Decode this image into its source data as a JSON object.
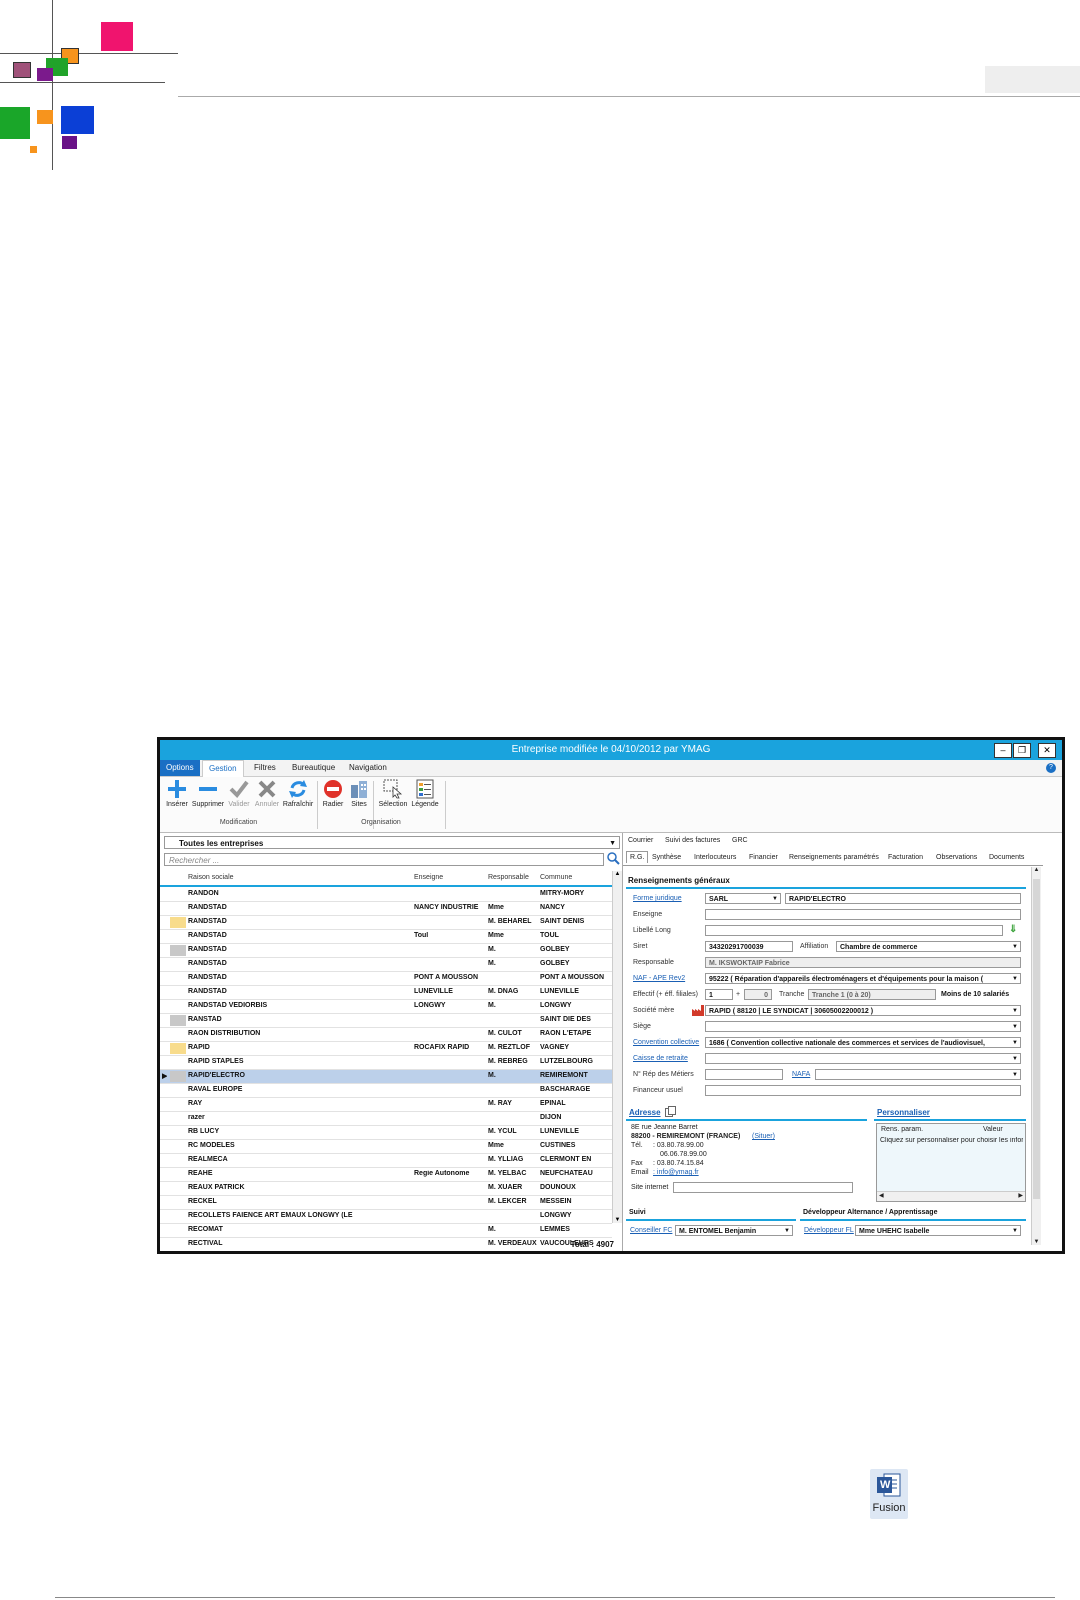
{
  "window": {
    "title": "Entreprise modifiée le 04/10/2012 par YMAG",
    "menu_tabs": [
      "Options",
      "Gestion",
      "Filtres",
      "Bureautique",
      "Navigation"
    ],
    "ribbon": {
      "buttons": [
        "Insérer",
        "Supprimer",
        "Valider",
        "Annuler",
        "Rafraîchir",
        "Radier",
        "Sites",
        "Sélection",
        "Légende"
      ],
      "groups": [
        "Modification",
        "Organisation"
      ]
    }
  },
  "left": {
    "filter": "Toutes les entreprises",
    "search_placeholder": "Rechercher ...",
    "columns": [
      "Raison sociale",
      "Enseigne",
      "Responsable",
      "Commune"
    ],
    "rows": [
      {
        "raison": "RANDON",
        "enseigne": "",
        "resp": "",
        "commune": "MITRY-MORY",
        "chip": ""
      },
      {
        "raison": "RANDSTAD",
        "enseigne": "NANCY INDUSTRIE",
        "resp": "Mme",
        "commune": "NANCY",
        "chip": ""
      },
      {
        "raison": "RANDSTAD",
        "enseigne": "",
        "resp": "M. BEHAREL",
        "commune": "SAINT DENIS",
        "chip": "#f8dc8c"
      },
      {
        "raison": "RANDSTAD",
        "enseigne": "Toul",
        "resp": "Mme",
        "commune": "TOUL",
        "chip": ""
      },
      {
        "raison": "RANDSTAD",
        "enseigne": "",
        "resp": "M.",
        "commune": "GOLBEY",
        "chip": "#c8c8c8"
      },
      {
        "raison": "RANDSTAD",
        "enseigne": "",
        "resp": "M.",
        "commune": "GOLBEY",
        "chip": ""
      },
      {
        "raison": "RANDSTAD",
        "enseigne": "PONT A MOUSSON",
        "resp": "",
        "commune": "PONT A MOUSSON",
        "chip": ""
      },
      {
        "raison": "RANDSTAD",
        "enseigne": "LUNEVILLE",
        "resp": "M. DNAG",
        "commune": "LUNEVILLE",
        "chip": ""
      },
      {
        "raison": "RANDSTAD VEDIORBIS",
        "enseigne": "LONGWY",
        "resp": "M.",
        "commune": "LONGWY",
        "chip": ""
      },
      {
        "raison": "RANSTAD",
        "enseigne": "",
        "resp": "",
        "commune": "SAINT DIE DES",
        "chip": "#c8c8c8"
      },
      {
        "raison": "RAON DISTRIBUTION",
        "enseigne": "",
        "resp": "M. CULOT",
        "commune": "RAON L'ETAPE",
        "chip": ""
      },
      {
        "raison": "RAPID",
        "enseigne": "ROCAFIX RAPID",
        "resp": "M. REZTLOF",
        "commune": "VAGNEY",
        "chip": "#f8dc8c"
      },
      {
        "raison": "RAPID STAPLES",
        "enseigne": "",
        "resp": "M. REBREG",
        "commune": "LUTZELBOURG",
        "chip": ""
      },
      {
        "raison": "RAPID'ELECTRO",
        "enseigne": "",
        "resp": "M.",
        "commune": "REMIREMONT",
        "chip": "#c8c8c8",
        "selected": true
      },
      {
        "raison": "RAVAL EUROPE",
        "enseigne": "",
        "resp": "",
        "commune": "BASCHARAGE",
        "chip": ""
      },
      {
        "raison": "RAY",
        "enseigne": "",
        "resp": "M. RAY",
        "commune": "EPINAL",
        "chip": ""
      },
      {
        "raison": "razer",
        "enseigne": "",
        "resp": "",
        "commune": "DIJON",
        "chip": ""
      },
      {
        "raison": "RB LUCY",
        "enseigne": "",
        "resp": "M. YCUL",
        "commune": "LUNEVILLE",
        "chip": ""
      },
      {
        "raison": "RC MODELES",
        "enseigne": "",
        "resp": "Mme",
        "commune": "CUSTINES",
        "chip": ""
      },
      {
        "raison": "REALMECA",
        "enseigne": "",
        "resp": "M. YLLIAG",
        "commune": "CLERMONT EN",
        "chip": ""
      },
      {
        "raison": "REAHE",
        "enseigne": "Regie Autonome",
        "resp": "M. YELBAC",
        "commune": "NEUFCHATEAU",
        "chip": ""
      },
      {
        "raison": "REAUX PATRICK",
        "enseigne": "",
        "resp": "M. XUAER",
        "commune": "DOUNOUX",
        "chip": ""
      },
      {
        "raison": "RECKEL",
        "enseigne": "",
        "resp": "M. LEKCER",
        "commune": "MESSEIN",
        "chip": ""
      },
      {
        "raison": "RECOLLETS FAIENCE ART EMAUX LONGWY (LE",
        "enseigne": "",
        "resp": "",
        "commune": "LONGWY",
        "chip": ""
      },
      {
        "raison": "RECOMAT",
        "enseigne": "",
        "resp": "M.",
        "commune": "LEMMES",
        "chip": ""
      },
      {
        "raison": "RECTIVAL",
        "enseigne": "",
        "resp": "M. VERDEAUX",
        "commune": "VAUCOULEURS",
        "chip": ""
      }
    ],
    "total": "Total : 4907"
  },
  "right": {
    "top_tabs": [
      "Courrier",
      "Suivi des factures",
      "GRC"
    ],
    "sub_tabs": [
      "R.G.",
      "Synthèse",
      "Interlocuteurs",
      "Financier",
      "Renseignements paramétrés",
      "Facturation",
      "Observations",
      "Documents"
    ],
    "section_rg": "Renseignements généraux",
    "forme_label": "Forme juridique",
    "forme_value": "SARL",
    "raison_value": "RAPID'ELECTRO",
    "enseigne_label": "Enseigne",
    "libelle_label": "Libellé Long",
    "siret_label": "Siret",
    "siret_value": "34320291700039",
    "affiliation_label": "Affiliation",
    "affiliation_value": "Chambre de commerce",
    "responsable_label": "Responsable",
    "responsable_value": "M. IKSWOKTAIP Fabrice",
    "naf_label": "NAF - APE Rev2",
    "naf_value": "95222 ( Réparation d'appareils électroménagers et d'équipements pour la maison (",
    "effectif_label": "Effectif (+ éff. filiales)",
    "effectif_value": "1",
    "effectif_plus": "+",
    "effectif_filiales": "0",
    "tranche_label": "Tranche",
    "tranche_value": "Tranche 1 (0 à 20)",
    "moins_label": "Moins de 10 salariés",
    "societe_label": "Société mère",
    "societe_value": "RAPID ( 88120 | LE SYNDICAT | 30605002200012 )",
    "siege_label": "Siège",
    "convention_label": "Convention collective",
    "convention_value": "1686 ( Convention collective nationale des commerces et services de l'audiovisuel,",
    "caisse_label": "Caisse de retraite",
    "rep_label": "N° Rép des Métiers",
    "nafa_label": "NAFA",
    "financeur_label": "Financeur usuel",
    "adresse_title": "Adresse",
    "address_line1": "8E rue Jeanne Barret",
    "address_line2": "88200 - REMIREMONT (FRANCE)",
    "situer": "(Situer)",
    "tel_label": "Tél.",
    "tel1": ": 03.80.78.99.00",
    "tel2": "06.06.78.99.00",
    "fax_label": "Fax",
    "fax": ": 03.80.74.15.84",
    "email_label": "Email",
    "email": ": info@ymag.fr",
    "site_label": "Site internet",
    "perso_title": "Personnaliser",
    "perso_col1": "Rens. param.",
    "perso_col2": "Valeur",
    "perso_hint": "Cliquez sur personnaliser pour choisir les inform",
    "suivi_title": "Suivi",
    "dev_title": "Développeur Alternance / Apprentissage",
    "conseiller_label": "Conseiller FC",
    "conseiller_value": "M. ENTOMEL Benjamin",
    "developpeur_label": "Développeur FL",
    "developpeur_value": "Mme UHEHC Isabelle"
  },
  "fusion": {
    "icon_letter": "W",
    "label": "Fusion"
  }
}
